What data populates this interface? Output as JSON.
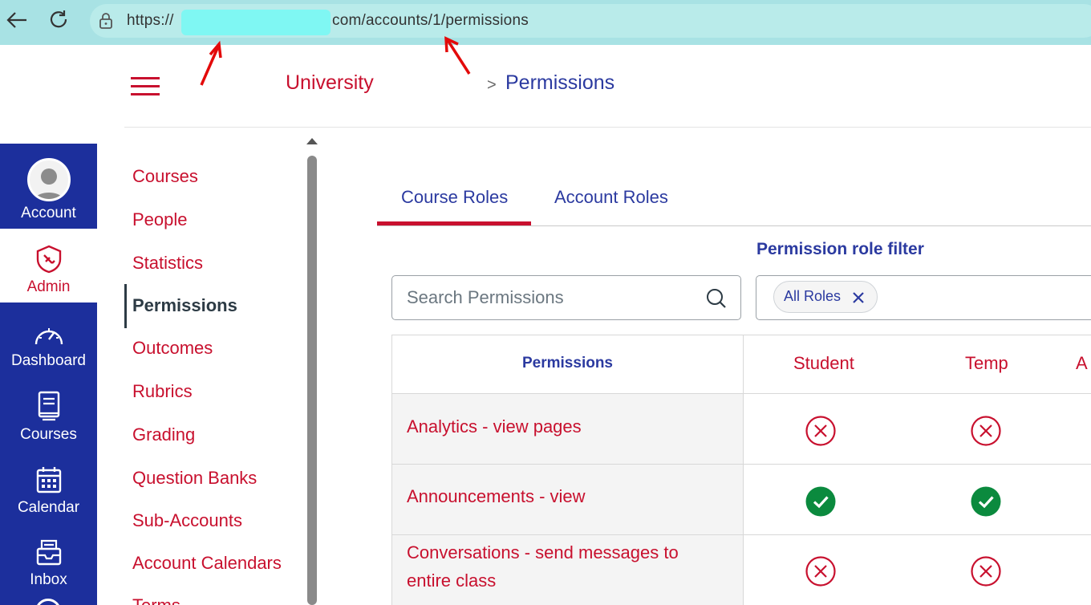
{
  "browser": {
    "url_prefix": "https://",
    "url_suffix": "com/accounts/1/permissions"
  },
  "header": {
    "breadcrumb_root": "University",
    "breadcrumb_separator": ">",
    "breadcrumb_current": "Permissions"
  },
  "global_nav": {
    "items": [
      {
        "label": "Account",
        "icon": "avatar"
      },
      {
        "label": "Admin",
        "icon": "shield-icon",
        "active": true
      },
      {
        "label": "Dashboard",
        "icon": "dashboard-icon"
      },
      {
        "label": "Courses",
        "icon": "book-icon"
      },
      {
        "label": "Calendar",
        "icon": "calendar-icon"
      },
      {
        "label": "Inbox",
        "icon": "inbox-icon"
      }
    ]
  },
  "sub_nav": {
    "items": [
      "Courses",
      "People",
      "Statistics",
      "Permissions",
      "Outcomes",
      "Rubrics",
      "Grading",
      "Question Banks",
      "Sub-Accounts",
      "Account Calendars",
      "Terms"
    ],
    "active": "Permissions"
  },
  "tabs": {
    "course_roles": "Course Roles",
    "account_roles": "Account Roles",
    "selected": "Course Roles"
  },
  "filters": {
    "search_placeholder": "Search Permissions",
    "role_filter_label": "Permission role filter",
    "chip_label": "All Roles"
  },
  "table": {
    "header_permissions": "Permissions",
    "roles": [
      "Student",
      "Temp",
      "A"
    ],
    "rows": [
      {
        "label": "Analytics - view pages",
        "student": "denied",
        "temp": "denied"
      },
      {
        "label": "Announcements - view",
        "student": "allowed",
        "temp": "allowed"
      },
      {
        "label_line1": "Conversations - send messages to",
        "label_line2": "entire class",
        "student": "denied",
        "temp": "denied"
      }
    ]
  },
  "colors": {
    "brand_red": "#c8102e",
    "brand_blue": "#2b3aa0",
    "nav_bg": "#1c2f9c",
    "allowed_green": "#0b8a3e",
    "browser_bar": "#a8e2e4"
  }
}
